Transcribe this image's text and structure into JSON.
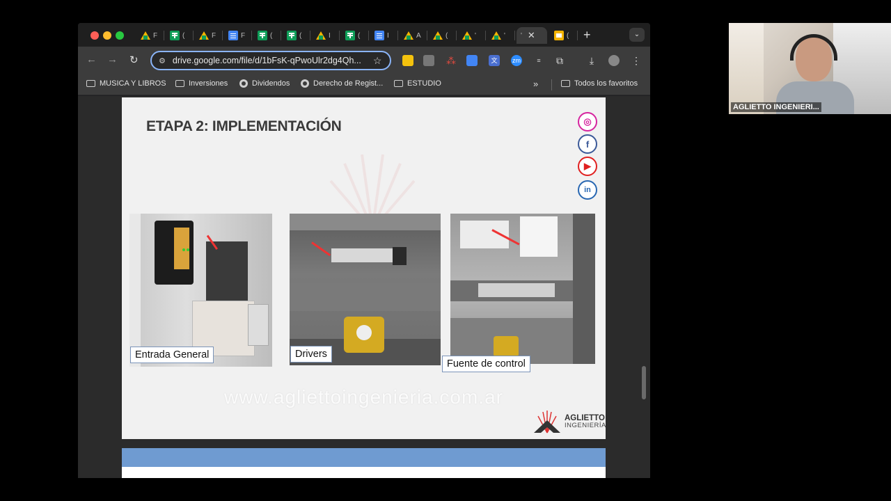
{
  "browser": {
    "tabs": [
      {
        "type": "drive",
        "label": "F"
      },
      {
        "type": "sheet",
        "label": "("
      },
      {
        "type": "drive",
        "label": "F"
      },
      {
        "type": "doc",
        "label": "F"
      },
      {
        "type": "sheet",
        "label": "("
      },
      {
        "type": "sheet",
        "label": "("
      },
      {
        "type": "drive",
        "label": "I"
      },
      {
        "type": "sheet",
        "label": "("
      },
      {
        "type": "doc",
        "label": "I"
      },
      {
        "type": "drive",
        "label": "A"
      },
      {
        "type": "drive",
        "label": "("
      },
      {
        "type": "drive",
        "label": "'"
      },
      {
        "type": "drive",
        "label": "'"
      },
      {
        "type": "active",
        "label": "'"
      },
      {
        "type": "slides",
        "label": "("
      }
    ],
    "new_tab_symbol": "+",
    "tab_menu_symbol": "⌄",
    "url": "drive.google.com/file/d/1bFsK-qPwoUlr2dg4Qh...",
    "bookmarks": [
      {
        "icon": "folder-icon",
        "label": "MUSICA Y LIBROS"
      },
      {
        "icon": "folder-icon",
        "label": "Inversiones"
      },
      {
        "icon": "globe-icon",
        "label": "Dividendos"
      },
      {
        "icon": "globe-icon",
        "label": "Derecho de Regist..."
      },
      {
        "icon": "folder-icon",
        "label": "ESTUDIO"
      }
    ],
    "bookmarks_overflow": "»",
    "all_bookmarks": "Todos los favoritos"
  },
  "slide": {
    "title": "ETAPA 2: IMPLEMENTACIÓN",
    "social_icons": [
      "instagram-icon",
      "facebook-icon",
      "youtube-icon",
      "linkedin-icon"
    ],
    "social_glyphs": {
      "instagram": "◎",
      "facebook": "f",
      "youtube": "▶",
      "linkedin": "in"
    },
    "captions": [
      "Entrada General",
      "Drivers",
      "Fuente de control"
    ],
    "website": "www.agliettoingenieria.com.ar",
    "logo_name": "AGLIETTO",
    "logo_sub": "INGENIERÍA"
  },
  "webcam": {
    "participant_name": "AGLIETTO INGENIERI..."
  },
  "colors": {
    "omnibox_border": "#8ab4f8",
    "next_slide_band": "#6f9bd1",
    "caption_border": "#7a93b8"
  }
}
